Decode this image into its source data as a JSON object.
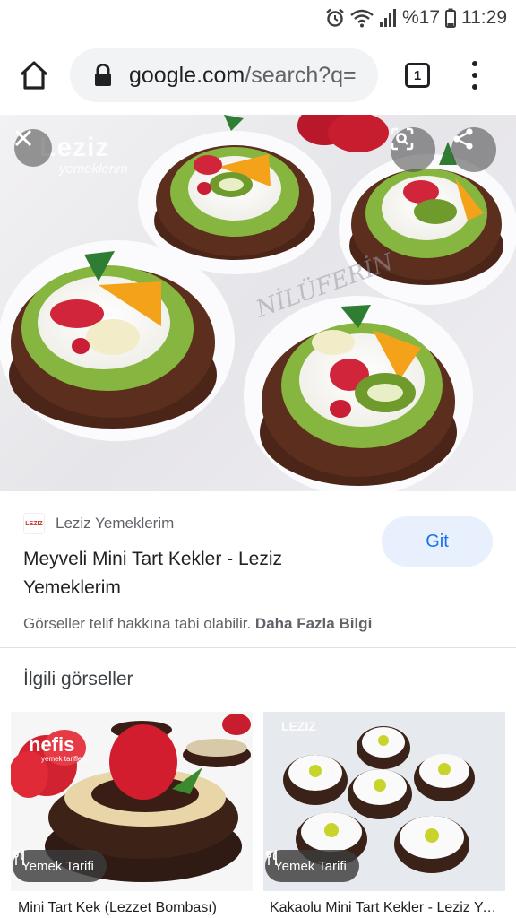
{
  "status_bar": {
    "battery_percent": "%17",
    "time": "11:29",
    "icons": [
      "alarm-icon",
      "wifi-icon",
      "signal-icon",
      "battery-icon"
    ]
  },
  "browser": {
    "url_host": "google.com",
    "url_rest": "/search?q=",
    "tab_count": "1",
    "icons": [
      "home-icon",
      "lock-icon",
      "tabs-icon",
      "more-vert-icon"
    ]
  },
  "hero": {
    "watermark_brand": "Leziz",
    "watermark_sub": "yemeklerim",
    "icons": [
      "close-icon",
      "lens-icon",
      "share-icon"
    ]
  },
  "result": {
    "source_logo_text": "LEZIZ",
    "source_name": "Leziz Yemeklerim",
    "title": "Meyveli Mini Tart Kekler - Leziz Yemeklerim",
    "visit_label": "Git",
    "copyright_text": "Görseller telif hakkına tabi olabilir.",
    "more_info_label": "Daha Fazla Bilgi"
  },
  "related": {
    "heading": "İlgili görseller",
    "items": [
      {
        "badge": "Yemek Tarifi",
        "caption": "Mini Tart Kek (Lezzet Bombası)",
        "logo": "nefis",
        "logo_sub": "yemek tarifleri"
      },
      {
        "badge": "Yemek Tarifi",
        "caption": "Kakaolu Mini Tart Kekler - Leziz Yemeklerim",
        "logo": "LEZIZ"
      }
    ]
  },
  "colors": {
    "accent": "#1a73e8",
    "visit_bg": "#e8f0fe",
    "omnibox_bg": "#f1f3f4"
  }
}
